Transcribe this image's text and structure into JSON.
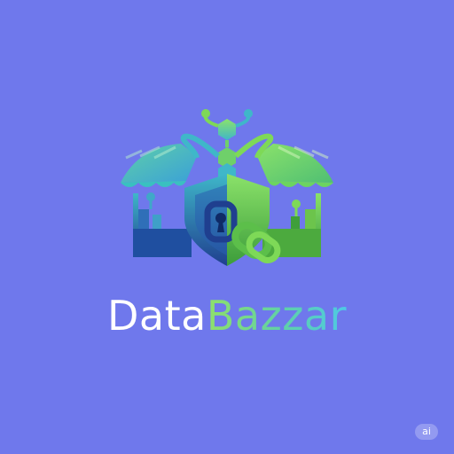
{
  "brand": {
    "name_part1": "Data",
    "name_part2": "Bazzar"
  },
  "badge": {
    "label": "ai"
  },
  "colors": {
    "background": "#6f78ec",
    "green": "#7ed957",
    "teal": "#3fb7c9",
    "navy": "#1f3f8f"
  },
  "icons": [
    "market-stall-icon",
    "shield-icon",
    "chain-link-icon",
    "blockchain-cube-icon"
  ]
}
